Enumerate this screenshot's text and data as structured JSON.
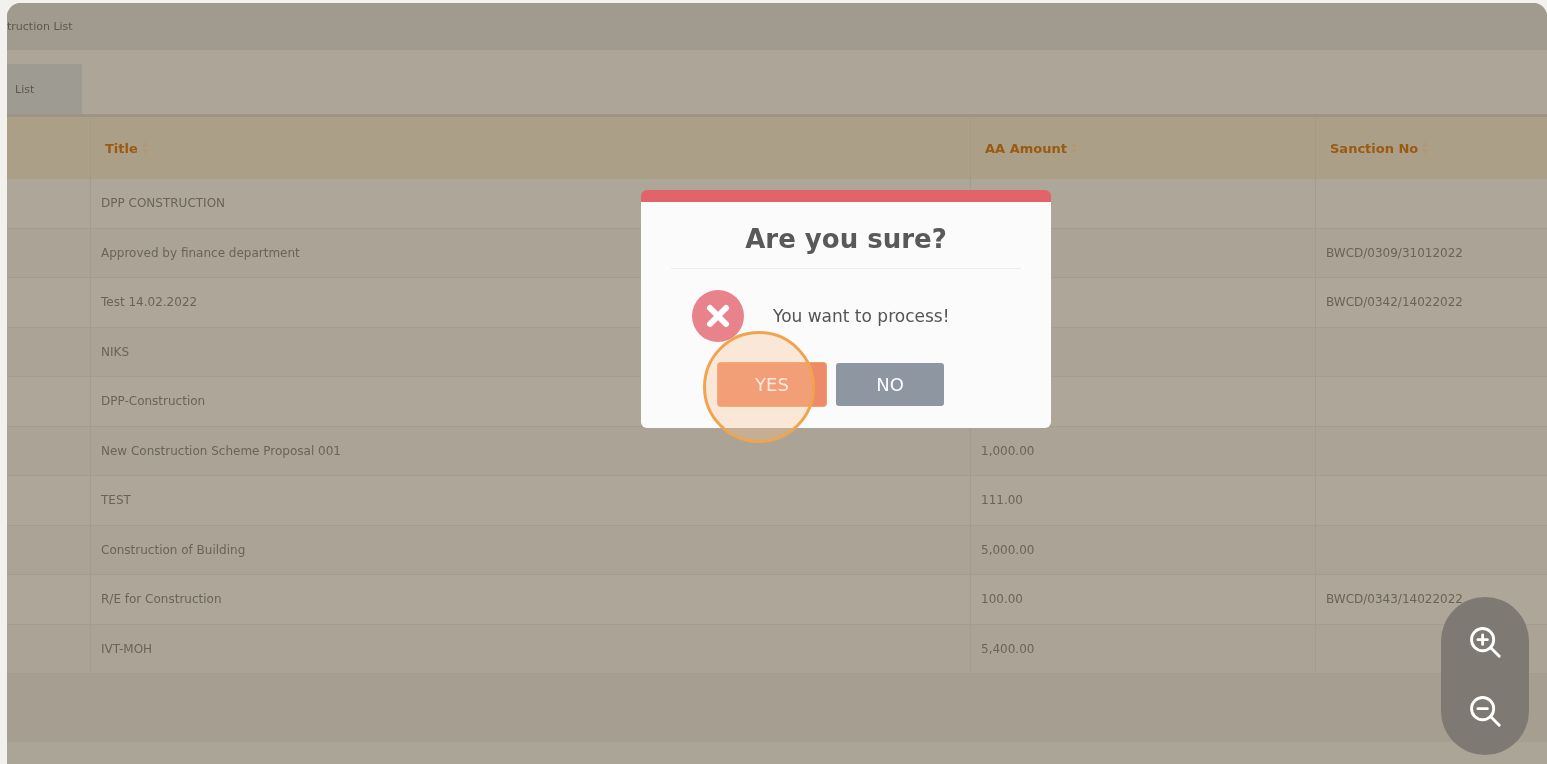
{
  "page_title": "truction List",
  "tabs": [
    {
      "label": "List",
      "selected": true
    }
  ],
  "table": {
    "columns": [
      "Title",
      "AA Amount",
      "Sanction No"
    ],
    "rows": [
      {
        "title": "DPP CONSTRUCTION"
      },
      {
        "title": "Approved by finance department",
        "sanction_no": "BWCD/0309/31012022"
      },
      {
        "title": "Test 14.02.2022",
        "sanction_no": "BWCD/0342/14022022"
      },
      {
        "title": "NIKS"
      },
      {
        "title": "DPP-Construction"
      },
      {
        "title": "New Construction Scheme Proposal 001",
        "amount": "1,000.00"
      },
      {
        "title": "TEST",
        "amount": "111.00"
      },
      {
        "title": "Construction of Building",
        "amount": "5,000.00"
      },
      {
        "title": "R/E for Construction",
        "amount": "100.00",
        "sanction_no": "BWCD/0343/14022022"
      },
      {
        "title": "IVT-MOH",
        "amount": "5,400.00"
      }
    ]
  },
  "dialog": {
    "title": "Are you sure?",
    "message": "You want to process!",
    "buttons": [
      {
        "label": "YES",
        "kind": "confirm",
        "focused": true
      },
      {
        "label": "NO",
        "kind": "cancel",
        "focused": false
      }
    ]
  }
}
